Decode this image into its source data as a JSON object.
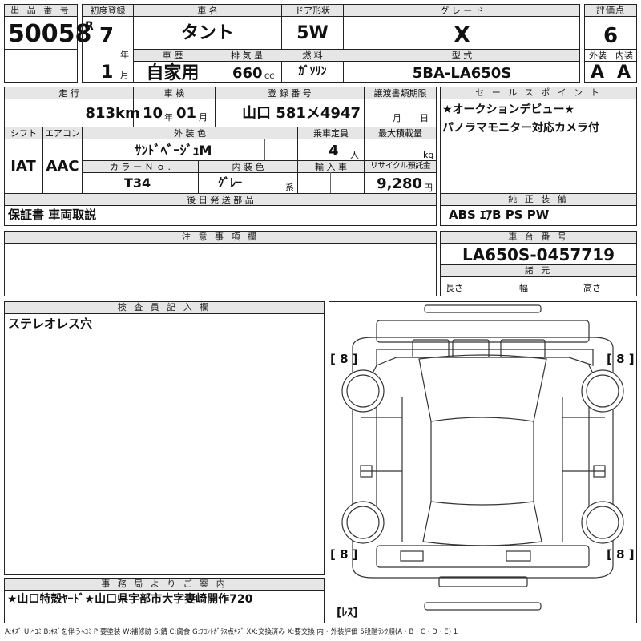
{
  "labels": {
    "lot_no": "出 品 番 号",
    "first_reg": "初度登録",
    "car_name": "車 名",
    "door": "ドア形状",
    "grade": "グ レ ー ド",
    "score": "評価点",
    "history": "車 歴",
    "displacement": "排 気 量",
    "fuel": "燃 料",
    "model": "型 式",
    "ext": "外装",
    "int": "内装",
    "mileage": "走 行",
    "inspection": "車 検",
    "reg_no": "登 録 番 号",
    "transfer": "譲渡書類期限",
    "sales_point": "セ ー ル ス ポ イ ン ト",
    "shift": "シフト",
    "aircon": "エアコン",
    "ext_color": "外 装 色",
    "capacity": "乗車定員",
    "max_load": "最大積載量",
    "color_no": "カ ラ ー Ｎ ｏ .",
    "int_color": "内 装 色",
    "import": "輸 入 車",
    "recycle": "リサイクル預託金",
    "later_parts": "後 日 発 送 部 品",
    "genuine": "純 正 装 備",
    "notes": "注 意 事 項 欄",
    "chassis": "車 台 番 号",
    "dims": "諸 元",
    "inspector": "検 査 員 記 入 欄",
    "office": "事 務 局 よ り ご 案 内"
  },
  "units": {
    "year": "年",
    "month": "月",
    "cc": "CC",
    "km": "km",
    "people": "人",
    "kg": "kg",
    "yen": "円",
    "series": "系",
    "length": "長さ",
    "width": "幅",
    "height": "高さ",
    "reiwa": "R"
  },
  "vehicle": {
    "lot_number": "50058",
    "reg_year": "7",
    "reg_month": "1",
    "name": "タント",
    "door": "5W",
    "grade": "X",
    "score": "6",
    "history": "自家用",
    "displacement": "660",
    "fuel": "ｶﾞｿﾘﾝ",
    "model": "5BA-LA650S",
    "ext_score": "A",
    "int_score": "A",
    "mileage": "813",
    "insp_year": "10",
    "insp_month": "01",
    "reg_number": "山口 581メ4947",
    "transfer_month": "月",
    "transfer_day": "日",
    "shift": "IAT",
    "aircon": "AAC",
    "ext_color": "ｻﾝﾄﾞﾍﾞｰｼﾞｭM",
    "capacity": "4",
    "color_no": "T34",
    "int_color": "ｸﾞﾚｰ",
    "recycle": "9,280",
    "chassis_number": "LA650S-0457719"
  },
  "sales_points": [
    "★オークションデビュー★",
    "パノラマモニター対応カメラ付"
  ],
  "later_parts": "保証書 車両取説",
  "genuine_equipment": "ABS ｴｱB PS PW",
  "inspector_notes": "ステレオレス穴",
  "office_notice": "★山口特殻ﾔｰﾄﾞ★山口県宇部市大字妻崎開作720",
  "diagram_marks": {
    "fl": "[ 8 ]",
    "fr": "[ 8 ]",
    "rl": "[ 8 ]",
    "rr": "[ 8 ]",
    "spare": "[ﾚｽ]"
  },
  "legend": "A:ｷｽﾞ U:ﾍｺﾐ B:ｷｽﾞを伴うﾍｺﾐ P:要塗装 W:補修跡 S:錆 C:腐食 G:ﾌﾛﾝﾄｶﾞﾗｽ点ｷｽﾞ XX:交換済み X:要交換 内・外装評価 5段階ﾗﾝｸ順(A・B・C・D・E) 1"
}
